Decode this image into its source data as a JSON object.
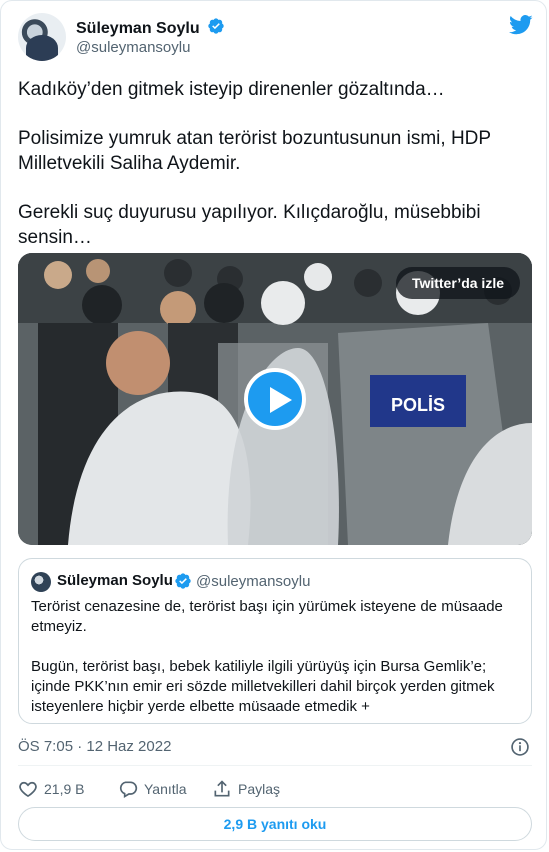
{
  "author": {
    "name": "Süleyman Soylu",
    "handle": "@suleymansoylu"
  },
  "tweet": {
    "paragraphs": [
      "Kadıköy’den gitmek isteyip direnenler gözaltında…",
      "Polisimize yumruk atan terörist bozuntusunun ismi, HDP Milletvekili Saliha Aydemir.",
      "Gerekli suç duyurusu yapılıyor. Kılıçdaroğlu, müsebbibi sensin…"
    ]
  },
  "media": {
    "watch_label": "Twitter’da izle",
    "shield_text": "POLİS"
  },
  "quote": {
    "name": "Süleyman Soylu",
    "handle": "@suleymansoylu",
    "paragraphs": [
      "Terörist cenazesine de, terörist başı için yürümek isteyene de müsaade etmeyiz.",
      "Bugün, terörist başı, bebek katiliyle ilgili yürüyüş için Bursa Gemlik’e; içinde PKK’nın emir eri sözde milletvekilleri dahil birçok yerden gitmek isteyenlere hiçbir yerde elbette müsaade etmedik +"
    ]
  },
  "meta": {
    "timestamp": "ÖS 7:05 · 12 Haz 2022"
  },
  "actions": {
    "likes": "21,9 B",
    "reply_label": "Yanıtla",
    "share_label": "Paylaş"
  },
  "replies_button": "2,9 B yanıtı oku",
  "colors": {
    "accent": "#1d9bf0",
    "text": "#0f1419",
    "muted": "#536471",
    "border": "#cfd9de"
  },
  "icons": [
    "verified-badge-icon",
    "twitter-bird-icon",
    "play-icon",
    "info-icon",
    "heart-icon",
    "reply-icon",
    "share-icon"
  ]
}
